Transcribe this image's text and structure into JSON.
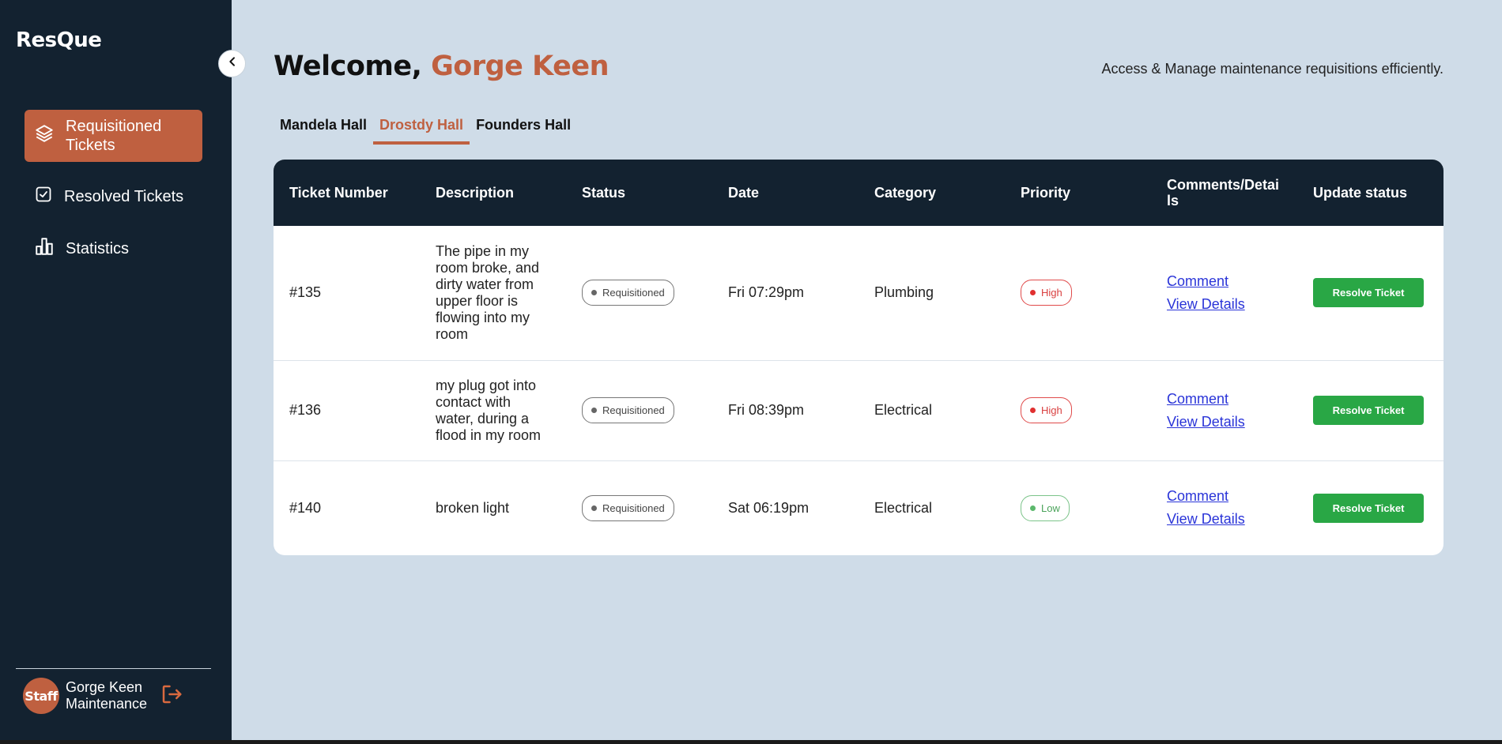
{
  "app": {
    "brand": "ResQue"
  },
  "sidebar": {
    "items": [
      {
        "label": "Requisitioned Tickets",
        "icon": "layers-icon",
        "active": true
      },
      {
        "label": "Resolved Tickets",
        "icon": "checkbox-icon",
        "active": false
      },
      {
        "label": "Statistics",
        "icon": "bar-chart-icon",
        "active": false
      }
    ],
    "user": {
      "avatar_text": "Staff",
      "name": "Gorge Keen",
      "role": "Maintenance"
    }
  },
  "header": {
    "welcome_prefix": "Welcome,",
    "user_name": "Gorge Keen",
    "tagline": "Access & Manage maintenance requisitions efficiently."
  },
  "tabs": [
    {
      "label": "Mandela Hall",
      "active": false
    },
    {
      "label": "Drostdy Hall",
      "active": true
    },
    {
      "label": "Founders Hall",
      "active": false
    }
  ],
  "table": {
    "columns": [
      "Ticket Number",
      "Description",
      "Status",
      "Date",
      "Category",
      "Priority",
      "Comments/Details",
      "Update status"
    ],
    "rows": [
      {
        "ticket": "#135",
        "description": "The pipe in my room broke, and dirty water from upper floor is flowing into my room",
        "status": "Requisitioned",
        "date": "Fri 07:29pm",
        "category": "Plumbing",
        "priority": "High",
        "comment": "Comment",
        "details": "View Details",
        "action": "Resolve Ticket"
      },
      {
        "ticket": "#136",
        "description": "my plug got into contact with water, during a flood in my room",
        "status": "Requisitioned",
        "date": "Fri 08:39pm",
        "category": "Electrical",
        "priority": "High",
        "comment": "Comment",
        "details": "View Details",
        "action": "Resolve Ticket"
      },
      {
        "ticket": "#140",
        "description": "broken light",
        "status": "Requisitioned",
        "date": "Sat 06:19pm",
        "category": "Electrical",
        "priority": "Low",
        "comment": "Comment",
        "details": "View Details",
        "action": "Resolve Ticket"
      }
    ]
  },
  "colors": {
    "accent": "#bf6040",
    "sidebar_bg": "#132230",
    "page_bg": "#cfdce8",
    "success": "#29a745",
    "priority_high": "#e03030",
    "priority_low": "#5cb86c"
  }
}
